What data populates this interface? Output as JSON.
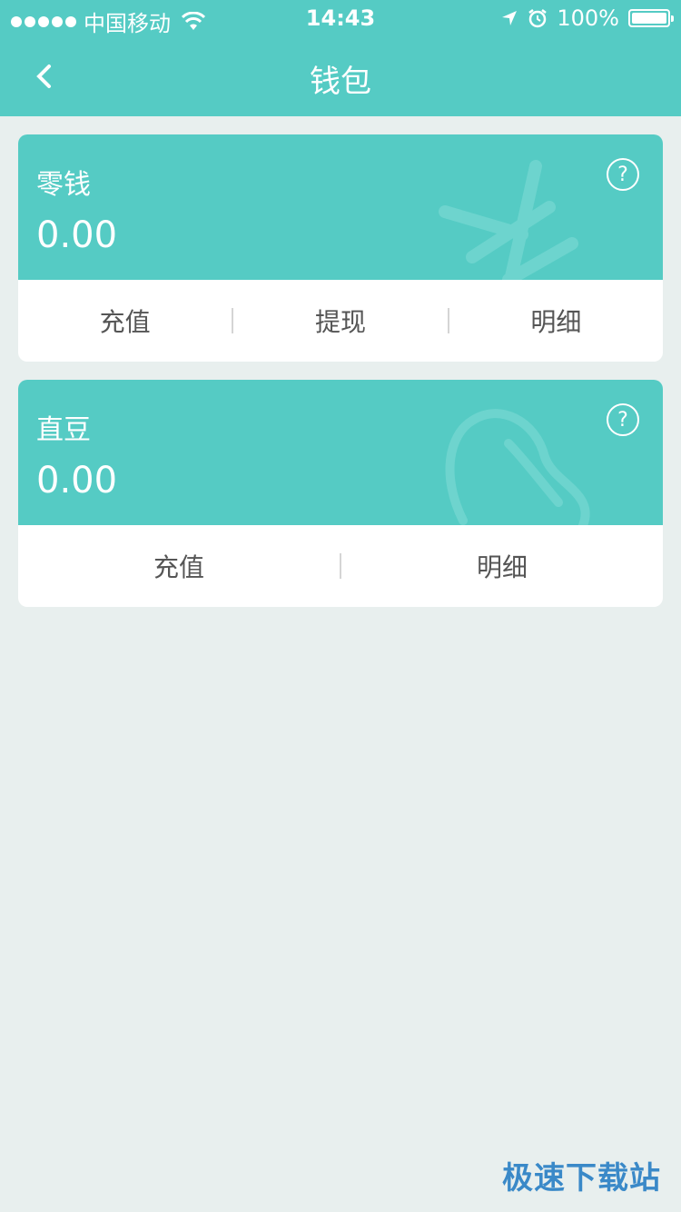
{
  "status": {
    "carrier": "中国移动",
    "time": "14:43",
    "battery": "100%"
  },
  "nav": {
    "title": "钱包"
  },
  "cards": [
    {
      "title": "零钱",
      "amount": "0.00",
      "actions": [
        "充值",
        "提现",
        "明细"
      ],
      "watermark_icon": "yuan-icon"
    },
    {
      "title": "直豆",
      "amount": "0.00",
      "actions": [
        "充值",
        "明细"
      ],
      "watermark_icon": "bean-icon"
    }
  ],
  "footer": {
    "brand": "极速下载站"
  },
  "colors": {
    "accent": "#55cbc4",
    "background": "#e8efee",
    "brand": "#3a89c8"
  }
}
